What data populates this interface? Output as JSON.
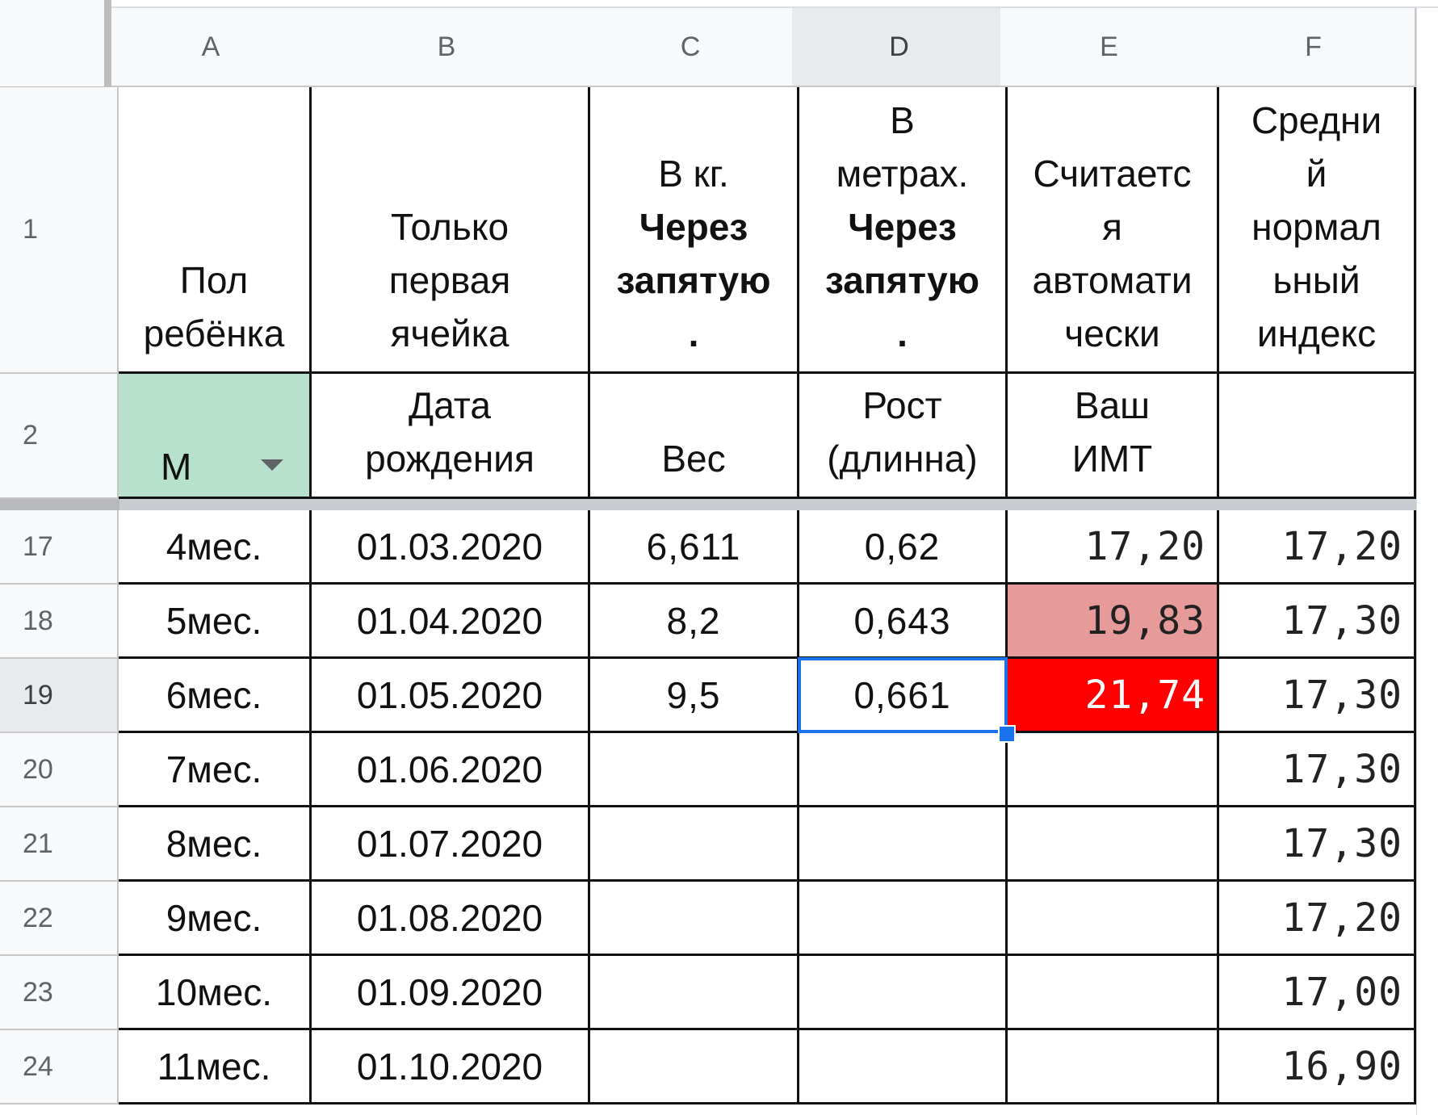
{
  "columns": [
    "A",
    "B",
    "C",
    "D",
    "E",
    "F"
  ],
  "selected_column": "D",
  "header_row": {
    "row_number": "1",
    "A": [
      "Пол",
      "ребёнка"
    ],
    "B": [
      "Только",
      "первая",
      "ячейка"
    ],
    "C": {
      "line1": "В кг.",
      "line2": "Через",
      "line3": "запятую",
      "line4": "."
    },
    "D": {
      "line1": "В",
      "line2": "метрах.",
      "line3": "Через",
      "line4": "запятую",
      "line5": "."
    },
    "E": [
      "Считаетс",
      "я",
      "автомати",
      "чески"
    ],
    "F": [
      "Средни",
      "й",
      "нормал",
      "ьный",
      "индекс"
    ]
  },
  "label_row": {
    "row_number": "2",
    "gender_value": "М",
    "B": [
      "Дата",
      "рождения"
    ],
    "C": "Вес",
    "D": [
      "Рост",
      "(длинна)"
    ],
    "E": [
      "Ваш",
      "ИМТ"
    ],
    "F": ""
  },
  "rows": [
    {
      "num": "17",
      "A": "4мес.",
      "B": "01.03.2020",
      "C": "6,611",
      "D": "0,62",
      "E": "17,20",
      "F": "17,20"
    },
    {
      "num": "18",
      "A": "5мес.",
      "B": "01.04.2020",
      "C": "8,2",
      "D": "0,643",
      "E": "19,83",
      "F": "17,30"
    },
    {
      "num": "19",
      "A": "6мес.",
      "B": "01.05.2020",
      "C": "9,5",
      "D": "0,661",
      "E": "21,74",
      "F": "17,30"
    },
    {
      "num": "20",
      "A": "7мес.",
      "B": "01.06.2020",
      "C": "",
      "D": "",
      "E": "",
      "F": "17,30"
    },
    {
      "num": "21",
      "A": "8мес.",
      "B": "01.07.2020",
      "C": "",
      "D": "",
      "E": "",
      "F": "17,30"
    },
    {
      "num": "22",
      "A": "9мес.",
      "B": "01.08.2020",
      "C": "",
      "D": "",
      "E": "",
      "F": "17,20"
    },
    {
      "num": "23",
      "A": "10мес.",
      "B": "01.09.2020",
      "C": "",
      "D": "",
      "E": "",
      "F": "17,00"
    },
    {
      "num": "24",
      "A": "11мес.",
      "B": "01.10.2020",
      "C": "",
      "D": "",
      "E": "",
      "F": "16,90"
    }
  ],
  "selected_cell": "D19",
  "colors": {
    "gender_fill": "#b7e1cd",
    "highlight_pink": "#e69a9a",
    "highlight_red": "#ff0000",
    "selection": "#1a73e8"
  },
  "icons": {
    "dropdown": "dropdown-arrow-icon"
  }
}
